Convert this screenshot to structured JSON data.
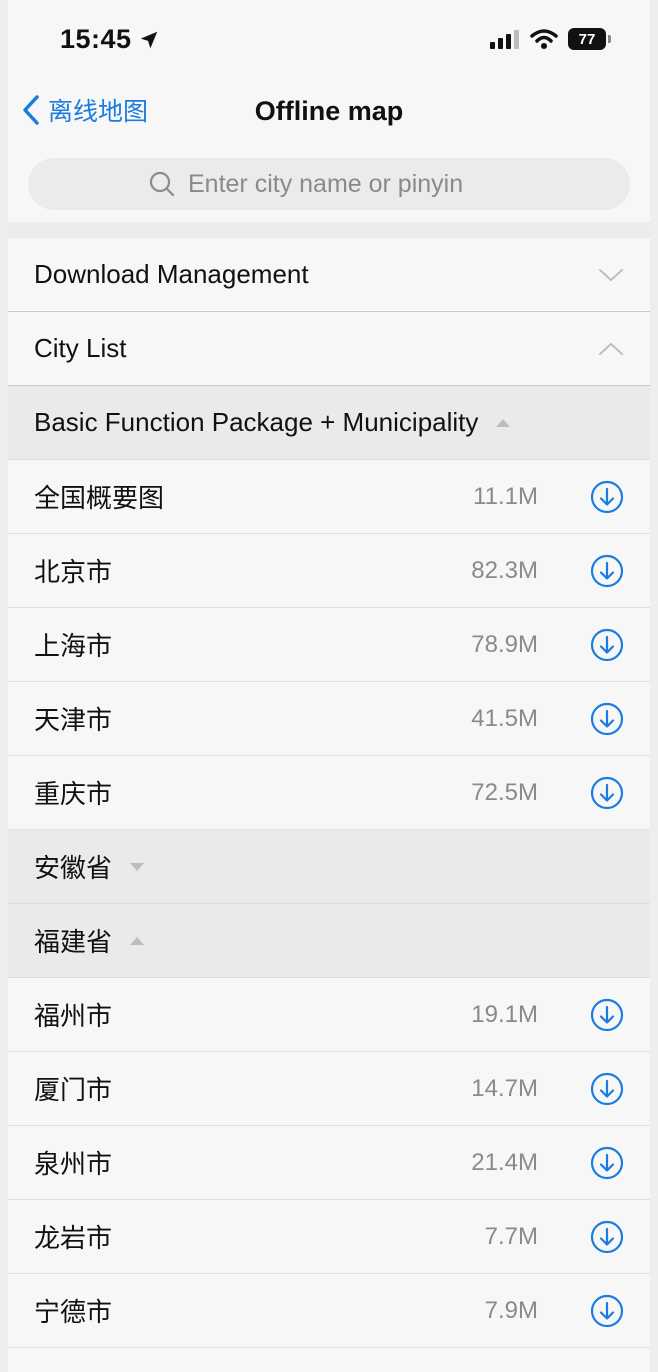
{
  "status": {
    "time": "15:45",
    "battery": "77"
  },
  "nav": {
    "back_label": "离线地图",
    "title": "Offline map"
  },
  "search": {
    "placeholder": "Enter city name or pinyin"
  },
  "sections": {
    "download_management": "Download Management",
    "city_list": "City List"
  },
  "groups": [
    {
      "title": "Basic Function Package + Municipality",
      "expanded": true,
      "cities": [
        {
          "name": "全国概要图",
          "size": "11.1M"
        },
        {
          "name": "北京市",
          "size": "82.3M"
        },
        {
          "name": "上海市",
          "size": "78.9M"
        },
        {
          "name": "天津市",
          "size": "41.5M"
        },
        {
          "name": "重庆市",
          "size": "72.5M"
        }
      ]
    },
    {
      "title": "安徽省",
      "expanded": false,
      "cities": []
    },
    {
      "title": "福建省",
      "expanded": true,
      "cities": [
        {
          "name": "福州市",
          "size": "19.1M"
        },
        {
          "name": "厦门市",
          "size": "14.7M"
        },
        {
          "name": "泉州市",
          "size": "21.4M"
        },
        {
          "name": "龙岩市",
          "size": "7.7M"
        },
        {
          "name": "宁德市",
          "size": "7.9M"
        }
      ]
    }
  ],
  "colors": {
    "accent": "#1a7ce0",
    "size_text": "#8a8a8a",
    "group_bg": "#eaeaea"
  }
}
